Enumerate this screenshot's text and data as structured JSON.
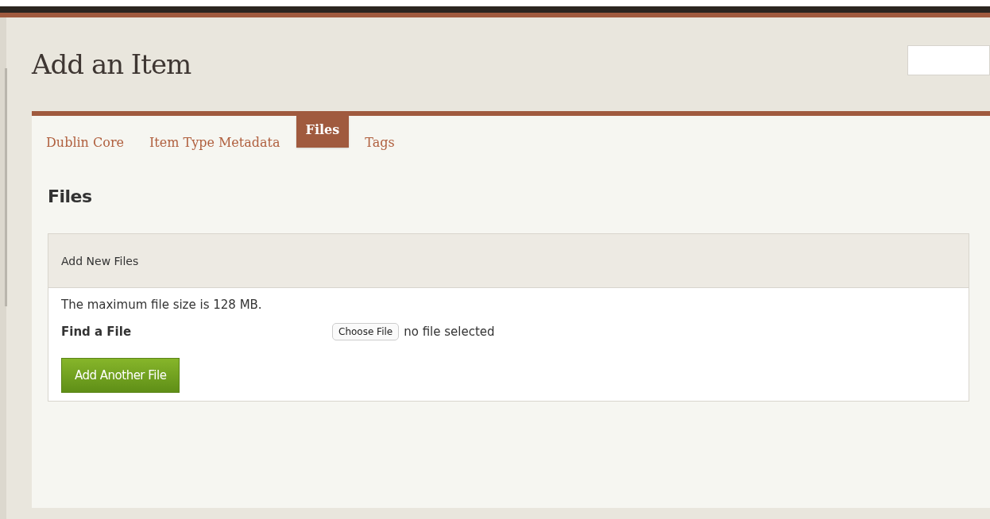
{
  "page": {
    "title": "Add an Item"
  },
  "tabs": [
    {
      "label": "Dublin Core",
      "selected": false
    },
    {
      "label": "Item Type Metadata",
      "selected": false
    },
    {
      "label": "Files",
      "selected": true
    },
    {
      "label": "Tags",
      "selected": false
    }
  ],
  "section": {
    "heading": "Files"
  },
  "panel": {
    "title": "Add New Files",
    "note": "The maximum file size is 128 MB.",
    "field_label": "Find a File",
    "file_button": "Choose File",
    "file_status": "no file selected",
    "add_button": "Add Another File"
  }
}
